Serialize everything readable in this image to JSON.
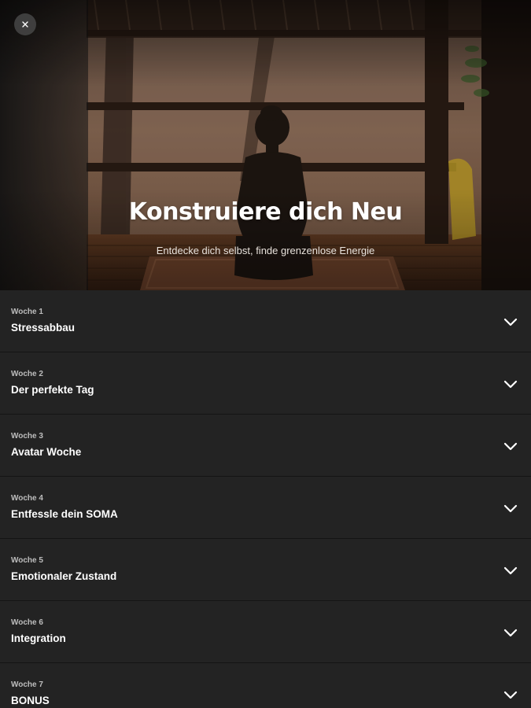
{
  "hero": {
    "title": "Konstruiere dich Neu",
    "subtitle": "Entdecke dich selbst, finde grenzenlose Energie"
  },
  "weeks": [
    {
      "label": "Woche 1",
      "title": "Stressabbau"
    },
    {
      "label": "Woche 2",
      "title": "Der perfekte Tag"
    },
    {
      "label": "Woche 3",
      "title": "Avatar Woche"
    },
    {
      "label": "Woche 4",
      "title": "Entfessle dein SOMA"
    },
    {
      "label": "Woche 5",
      "title": "Emotionaler Zustand"
    },
    {
      "label": "Woche 6",
      "title": "Integration"
    },
    {
      "label": "Woche 7",
      "title": "BONUS"
    }
  ],
  "icons": {
    "close": "close-icon",
    "expand": "chevron-down-icon"
  },
  "colors": {
    "background": "#232323",
    "divider": "#141414",
    "text_primary": "#ffffff",
    "text_secondary": "#bdbdbd"
  }
}
